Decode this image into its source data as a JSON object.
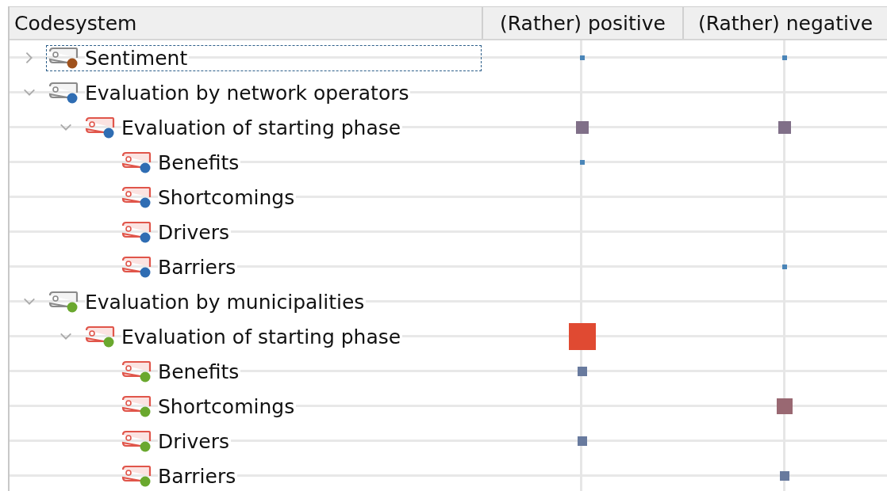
{
  "columns": [
    "Codesystem",
    "(Rather) positive",
    "(Rather) negative"
  ],
  "codes": [
    {
      "label": "Sentiment",
      "kind": "group",
      "expanded": false,
      "selected": true,
      "color": "#a0521c",
      "cells": [
        {
          "kind": "tiny",
          "color": "#4a85b8"
        },
        {
          "kind": "tiny",
          "color": "#4a85b8"
        }
      ]
    },
    {
      "label": "Evaluation by network operators",
      "kind": "group",
      "expanded": true,
      "selected": false,
      "color": "#2f6db3",
      "cells": [
        null,
        null
      ],
      "children": [
        {
          "label": "Evaluation of starting phase",
          "kind": "code",
          "expanded": true,
          "selected": false,
          "color": "#2f6db3",
          "cells": [
            {
              "kind": "medium",
              "color": "#806f88"
            },
            {
              "kind": "medium",
              "color": "#806f88"
            }
          ],
          "children": [
            {
              "label": "Benefits",
              "kind": "code",
              "selected": false,
              "color": "#2f6db3",
              "cells": [
                {
                  "kind": "tiny",
                  "color": "#4a85b8"
                },
                null
              ]
            },
            {
              "label": "Shortcomings",
              "kind": "code",
              "selected": false,
              "color": "#2f6db3",
              "cells": [
                null,
                null
              ]
            },
            {
              "label": "Drivers",
              "kind": "code",
              "selected": false,
              "color": "#2f6db3",
              "cells": [
                null,
                null
              ]
            },
            {
              "label": "Barriers",
              "kind": "code",
              "selected": false,
              "color": "#2f6db3",
              "cells": [
                null,
                {
                  "kind": "tiny",
                  "color": "#4a85b8"
                }
              ]
            }
          ]
        }
      ]
    },
    {
      "label": "Evaluation by municipalities",
      "kind": "group",
      "expanded": true,
      "selected": false,
      "color": "#6aa82e",
      "cells": [
        null,
        null
      ],
      "children": [
        {
          "label": "Evaluation of starting phase",
          "kind": "code",
          "expanded": true,
          "selected": false,
          "color": "#6aa82e",
          "cells": [
            {
              "kind": "huge",
              "color": "#e04a32"
            },
            null
          ],
          "children": [
            {
              "label": "Benefits",
              "kind": "code",
              "selected": false,
              "color": "#6aa82e",
              "cells": [
                {
                  "kind": "small",
                  "color": "#687a9e"
                },
                null
              ]
            },
            {
              "label": "Shortcomings",
              "kind": "code",
              "selected": false,
              "color": "#6aa82e",
              "cells": [
                null,
                {
                  "kind": "large",
                  "color": "#996872"
                }
              ]
            },
            {
              "label": "Drivers",
              "kind": "code",
              "selected": false,
              "color": "#6aa82e",
              "cells": [
                {
                  "kind": "small",
                  "color": "#687a9e"
                },
                null
              ]
            },
            {
              "label": "Barriers",
              "kind": "code",
              "selected": false,
              "color": "#6aa82e",
              "cells": [
                null,
                {
                  "kind": "small",
                  "color": "#687a9e"
                }
              ]
            }
          ]
        }
      ]
    }
  ]
}
